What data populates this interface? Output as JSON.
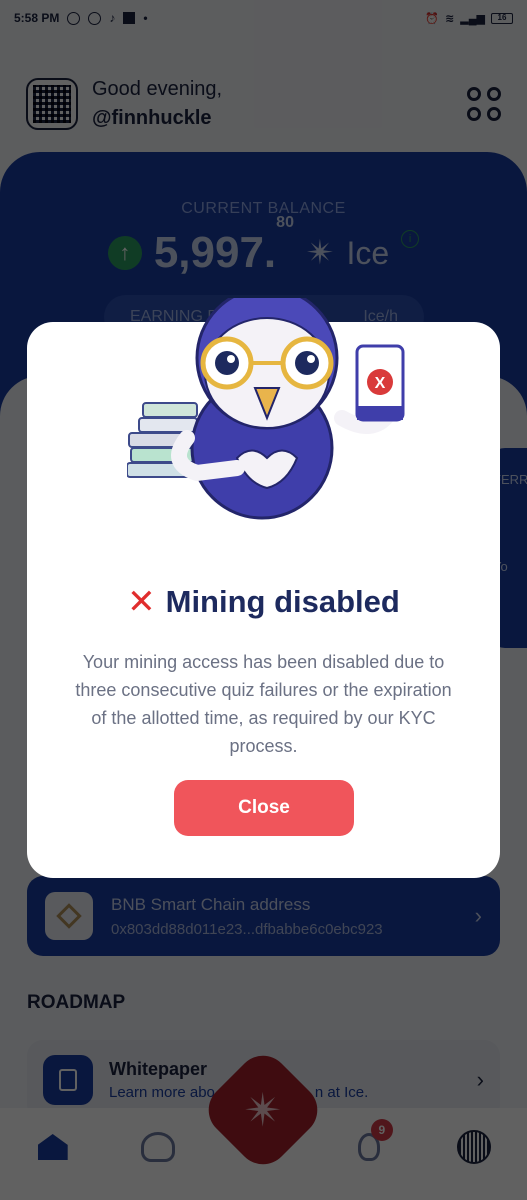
{
  "status_bar": {
    "time": "5:58 PM",
    "battery": "16"
  },
  "header": {
    "greeting": "Good evening,",
    "username": "@finnhuckle"
  },
  "balance": {
    "label": "CURRENT BALANCE",
    "amount": "5,997.",
    "decimals": "80",
    "unit": "Ice",
    "earning_prefix": "EARNING R",
    "earning_unit": "Ice/h"
  },
  "referral_card": {
    "text_top": "FERR",
    "text_bottom": "Yo"
  },
  "bnb": {
    "title": "BNB Smart Chain address",
    "address": "0x803dd88d011e23...dfbabbe6c0ebc923"
  },
  "roadmap": {
    "heading": "ROADMAP",
    "whitepaper_title": "Whitepaper",
    "whitepaper_sub": "Learn more abo                        n at Ice."
  },
  "tabbar": {
    "notifications_badge": "9"
  },
  "modal": {
    "illustration_phone_mark": "X",
    "title": "Mining disabled",
    "body": "Your mining access has been disabled due to three consecutive quiz failures or the expiration of the allotted time, as required by our KYC process.",
    "close_label": "Close"
  },
  "icons": {
    "status": [
      "shield-icon",
      "tiktok-icon",
      "alarm-icon",
      "wifi-icon",
      "signal-icon",
      "battery-icon"
    ],
    "tabbar": [
      "home-icon",
      "team-icon",
      "ice-logo-icon",
      "bulb-icon",
      "profile-icon"
    ]
  },
  "colors": {
    "brand_blue": "#1a3ea3",
    "close_button": "#f0555b",
    "error_red": "#e02d2d",
    "green": "#2c9e62"
  }
}
